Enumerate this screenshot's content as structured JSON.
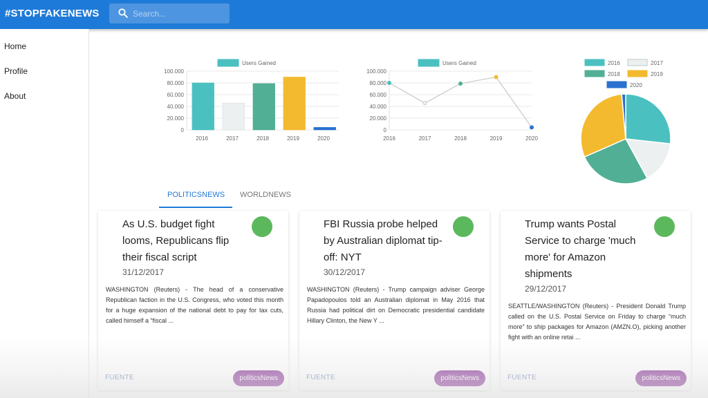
{
  "app": {
    "brand": "#STOPFAKENEWS"
  },
  "search": {
    "placeholder": "Search..."
  },
  "sidebar": {
    "items": [
      {
        "label": "Home"
      },
      {
        "label": "Profile"
      },
      {
        "label": "About"
      }
    ]
  },
  "colors": {
    "topbar": "#1e7ad8",
    "tab_active": "#1e7ad8",
    "badge": "#7b1b8c",
    "avatar": "#5cb85c"
  },
  "chart_data": [
    {
      "type": "bar",
      "categories": [
        "2016",
        "2017",
        "2018",
        "2019",
        "2020"
      ],
      "series": [
        {
          "name": "Users Gained",
          "values": [
            80000,
            45677,
            78888,
            90000,
            4300
          ]
        }
      ],
      "colors": [
        "#4bc0c0",
        "#ecf0f1",
        "#50af95",
        "#f3ba2f",
        "#2a71d0"
      ],
      "ylim": [
        0,
        100000
      ],
      "yticks": [
        "0",
        "20.000",
        "40.000",
        "60.000",
        "80.000",
        "100.000"
      ],
      "legend": "top"
    },
    {
      "type": "line",
      "categories": [
        "2016",
        "2017",
        "2018",
        "2019",
        "2020"
      ],
      "series": [
        {
          "name": "Users Gained",
          "values": [
            80000,
            45677,
            78888,
            90000,
            4300
          ]
        }
      ],
      "colors": [
        "#4bc0c0",
        "#ecf0f1",
        "#50af95",
        "#f3ba2f",
        "#2a71d0"
      ],
      "legend_color": "#4bc0c0",
      "ylim": [
        0,
        100000
      ],
      "yticks": [
        "0",
        "20.000",
        "40.000",
        "60.000",
        "80.000",
        "100.000"
      ],
      "legend": "top"
    },
    {
      "type": "pie",
      "categories": [
        "2016",
        "2017",
        "2018",
        "2019",
        "2020"
      ],
      "values": [
        80000,
        45677,
        78888,
        90000,
        4300
      ],
      "colors": [
        "#4bc0c0",
        "#ecf0f1",
        "#50af95",
        "#f3ba2f",
        "#2a71d0"
      ],
      "legend": "top"
    }
  ],
  "tabs": [
    {
      "label": "POLITICSNEWS",
      "active": true
    },
    {
      "label": "WORLDNEWS",
      "active": false
    }
  ],
  "articles": [
    {
      "title": "As U.S. budget fight looms, Republicans flip their fiscal script",
      "date": "31/12/2017",
      "body": "WASHINGTON (Reuters) - The head of a conservative Republican faction in the U.S. Congress, who voted this month for a huge expansion of the national debt to pay for tax cuts, called himself a “fiscal ...",
      "source": "FUENTE",
      "tag": "politicsNews"
    },
    {
      "title": "FBI Russia probe helped by Australian diplomat tip-off: NYT",
      "date": "30/12/2017",
      "body": "WASHINGTON (Reuters) - Trump campaign adviser George Papadopoulos told an Australian diplomat in May 2016 that Russia had political dirt on Democratic presidential candidate Hillary Clinton, the New Y ...",
      "source": "FUENTE",
      "tag": "politicsNews"
    },
    {
      "title": "Trump wants Postal Service to charge 'much more' for Amazon shipments",
      "date": "29/12/2017",
      "body": "SEATTLE/WASHINGTON (Reuters) - President Donald Trump called on the U.S. Postal Service on Friday to charge “much more” to ship packages for Amazon (AMZN.O), picking another fight with an online retai ...",
      "source": "FUENTE",
      "tag": "politicsNews"
    }
  ]
}
